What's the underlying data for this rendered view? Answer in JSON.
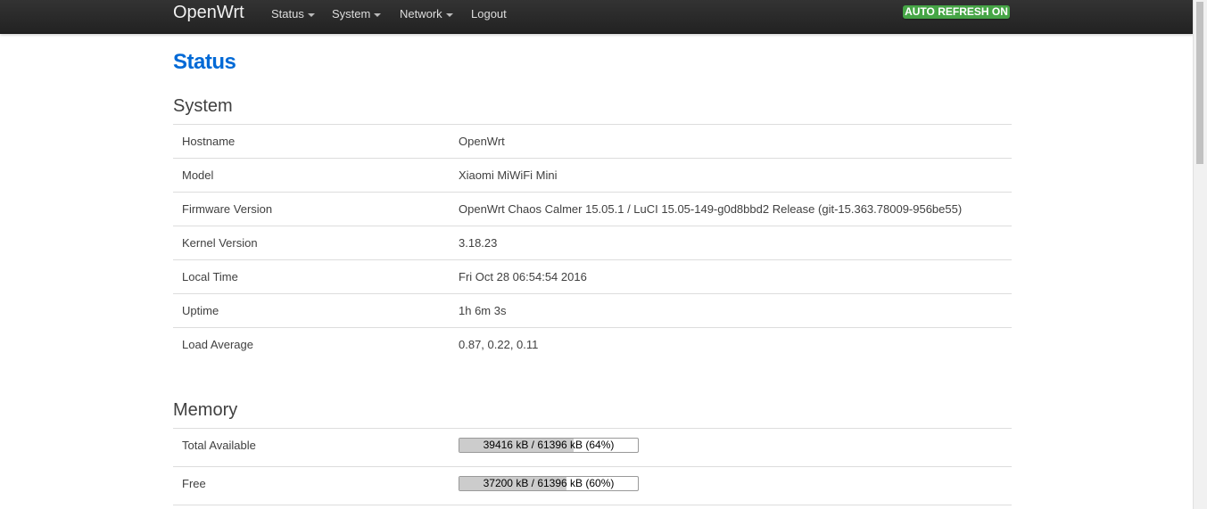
{
  "navbar": {
    "brand": "OpenWrt",
    "menu": [
      "Status",
      "System",
      "Network",
      "Logout"
    ],
    "auto_refresh": "AUTO REFRESH ON",
    "colors": {
      "background": "#222222",
      "badge": "#46a546"
    }
  },
  "page_title": "Status",
  "system": {
    "title": "System",
    "rows": [
      {
        "label": "Hostname",
        "value": "OpenWrt"
      },
      {
        "label": "Model",
        "value": "Xiaomi MiWiFi Mini"
      },
      {
        "label": "Firmware Version",
        "value": "OpenWrt Chaos Calmer 15.05.1 / LuCI 15.05-149-g0d8bbd2 Release (git-15.363.78009-956be55)"
      },
      {
        "label": "Kernel Version",
        "value": "3.18.23"
      },
      {
        "label": "Local Time",
        "value": "Fri Oct 28 06:54:54 2016"
      },
      {
        "label": "Uptime",
        "value": "1h 6m 3s"
      },
      {
        "label": "Load Average",
        "value": "0.87, 0.22, 0.11"
      }
    ]
  },
  "memory": {
    "title": "Memory",
    "rows": [
      {
        "label": "Total Available",
        "bar_text": "39416 kB / 61396 kB (64%)",
        "percent": 64
      },
      {
        "label": "Free",
        "bar_text": "37200 kB / 61396 kB (60%)",
        "percent": 60
      }
    ]
  },
  "colors": {
    "title": "#0069d6",
    "bar_fill": "#cccccc"
  }
}
